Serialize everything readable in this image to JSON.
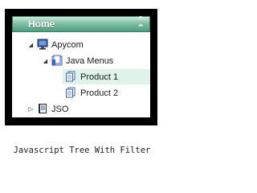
{
  "menu": {
    "header_label": "Home",
    "header_icon": "double-chevron-up-icon",
    "items": [
      {
        "label": "Apycom",
        "icon": "monitor-icon",
        "expanded": true
      },
      {
        "label": "Java Menus",
        "icon": "folder-document-icon",
        "expanded": true
      },
      {
        "label": "Product 1",
        "icon": "document-icon",
        "selected": true
      },
      {
        "label": "Product 2",
        "icon": "document-icon"
      },
      {
        "label": "JSO",
        "icon": "book-icon",
        "expanded": false
      }
    ]
  },
  "caption": "Javascript Tree With Filter",
  "colors": {
    "header_green": "#4f9d80",
    "selected_bg": "#dff3ea",
    "frame": "#000000"
  }
}
